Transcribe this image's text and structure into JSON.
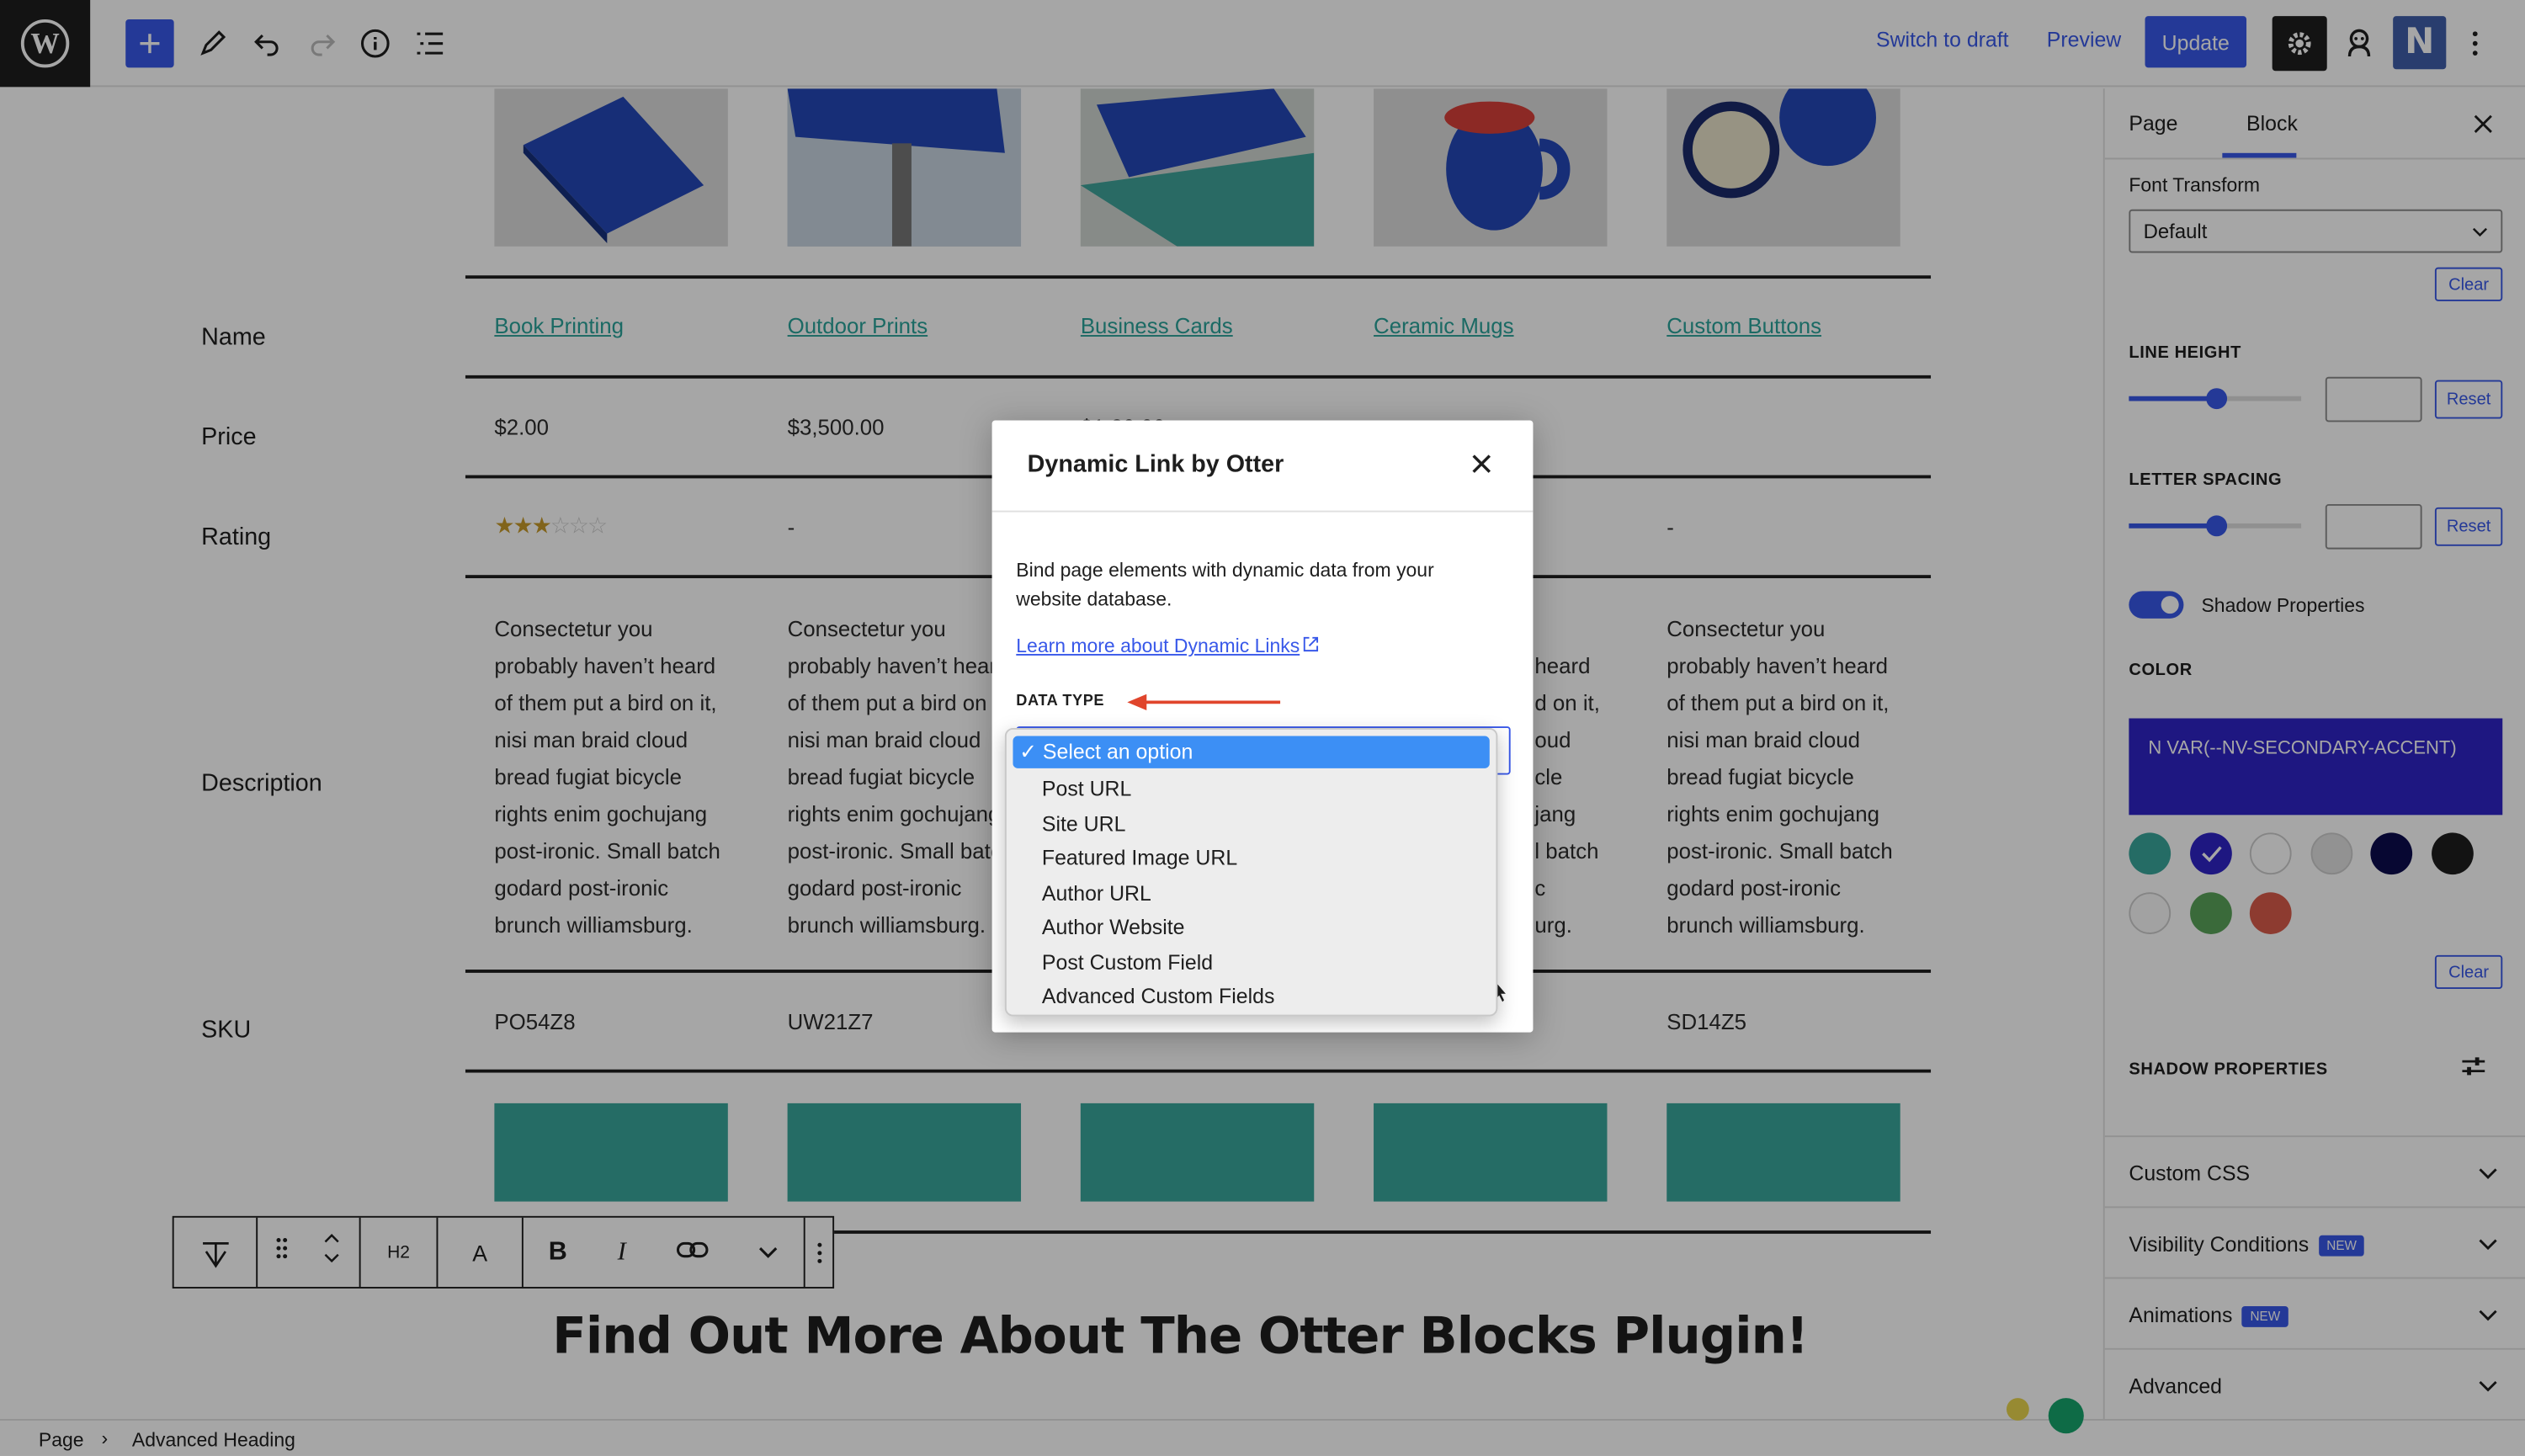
{
  "topbar": {
    "switch_to_draft": "Switch to draft",
    "preview": "Preview",
    "update": "Update",
    "neve_letter": "N"
  },
  "table": {
    "row_labels": [
      "Name",
      "Price",
      "Rating",
      "Description",
      "SKU"
    ],
    "products": [
      {
        "name": "Book Printing",
        "price": "$2.00",
        "rating_stars": 3,
        "rating_text": "",
        "description": "Consectetur you probably haven’t heard of them put a bird on it, nisi man braid cloud bread fugiat bicycle rights enim gochujang post-ironic. Small batch godard post-ironic brunch williamsburg.",
        "sku": "PO54Z8"
      },
      {
        "name": "Outdoor Prints",
        "price": "$3,500.00",
        "rating_text": "-",
        "description": "Consectetur you probably haven’t heard of them put a bird on it, nisi man braid cloud bread fugiat bicycle rights enim gochujang post-ironic. Small batch godard post-ironic brunch williamsburg.",
        "sku": "UW21Z7"
      },
      {
        "name": "Business Cards",
        "price": "$1,20.00",
        "description_partial": "",
        "sku": ""
      },
      {
        "name": "Ceramic Mugs",
        "description_partial_lines": [
          "heard",
          "d on it,",
          "oud",
          "cle",
          "jang",
          "l batch",
          "c",
          "urg."
        ]
      },
      {
        "name": "Custom Buttons",
        "rating_text": "-",
        "description": "Consectetur you probably haven’t heard of them put a bird on it, nisi man braid cloud bread fugiat bicycle rights enim gochujang post-ironic. Small batch godard post-ironic brunch williamsburg.",
        "sku": "SD14Z5"
      }
    ],
    "desc_lines": [
      "Consectetur you",
      "probably haven’t heard",
      "of them put a bird on it,",
      "nisi man braid cloud",
      "bread fugiat bicycle",
      "rights enim gochujang",
      "post-ironic. Small batch",
      "godard post-ironic",
      "brunch williamsburg."
    ],
    "desc_lines_col2": [
      "Consectetur you",
      "probably haven’t hear",
      "of them put a bird on i",
      "nisi man braid cloud",
      "bread fugiat bicycle",
      "rights enim gochujang",
      "post-ironic. Small batc",
      "godard post-ironic",
      "brunch williamsburg."
    ]
  },
  "block_toolbar": {
    "heading_level": "H2",
    "text_color_label": "A"
  },
  "heading": "Find Out More About The Otter Blocks Plugin!",
  "sidebar": {
    "tab_page": "Page",
    "tab_block": "Block",
    "font_transform_label": "Font Transform",
    "font_transform_value": "Default",
    "clear": "Clear",
    "line_height_label": "LINE HEIGHT",
    "letter_spacing_label": "LETTER SPACING",
    "reset": "Reset",
    "line_height_slider": 0.5,
    "letter_spacing_slider": 0.5,
    "shadow_toggle_label": "Shadow Properties",
    "color_label": "COLOR",
    "color_value_text": "N  VAR(--NV-SECONDARY-ACCENT)",
    "color_value": "#2f24c7",
    "swatches": [
      "#3aa69b",
      "#2f24c7",
      "#ffffff",
      "#e0e0e0",
      "#0b0b4d",
      "#1e1e1e",
      "#f9f9f9",
      "#5aa35a",
      "#d95b4b"
    ],
    "shadow_properties_caps": "SHADOW PROPERTIES",
    "custom_css": "Custom CSS",
    "visibility_conditions": "Visibility Conditions",
    "animations": "Animations",
    "advanced": "Advanced",
    "new_badge": "NEW"
  },
  "breadcrumb": {
    "page": "Page",
    "separator": "›",
    "block": "Advanced Heading"
  },
  "modal": {
    "title": "Dynamic Link by Otter",
    "description": "Bind page elements with dynamic data from your website database.",
    "learn_more": "Learn more about Dynamic Links",
    "data_type_label": "DATA TYPE",
    "options": [
      "Select an option",
      "Post URL",
      "Site URL",
      "Featured Image URL",
      "Author URL",
      "Author Website",
      "Post Custom Field",
      "Advanced Custom Fields"
    ],
    "selected_index": 0,
    "checkmark": "✓"
  },
  "colors": {
    "accent": "#3858e9",
    "teal": "#3aa69b",
    "link": "#2aa39a",
    "arrow": "#e0452c"
  }
}
